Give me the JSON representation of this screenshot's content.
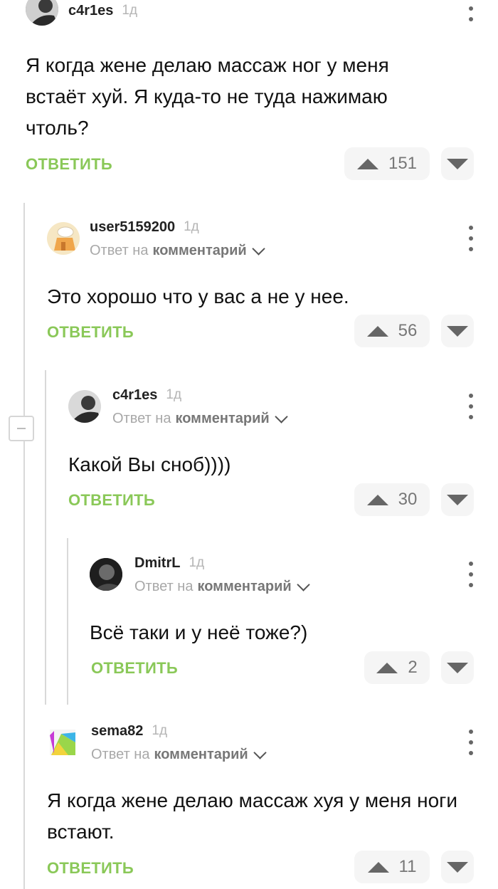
{
  "comments": [
    {
      "author": "c4r1es",
      "time": "1д",
      "text": "Я когда жене делаю массаж ног у меня встаёт хуй. Я куда-то не туда нажимаю чтоль?",
      "reply_label": "ОТВЕТИТЬ",
      "score": "151"
    },
    {
      "author": "user5159200",
      "time": "1д",
      "reply_to_prefix": "Ответ на",
      "reply_to_link": "комментарий",
      "text": "Это хорошо что у вас а не у нее.",
      "reply_label": "ОТВЕТИТЬ",
      "score": "56"
    },
    {
      "author": "c4r1es",
      "time": "1д",
      "reply_to_prefix": "Ответ на",
      "reply_to_link": "комментарий",
      "text": "Какой Вы сноб))))",
      "reply_label": "ОТВЕТИТЬ",
      "score": "30"
    },
    {
      "author": "DmitrL",
      "time": "1д",
      "reply_to_prefix": "Ответ на",
      "reply_to_link": "комментарий",
      "text": "Всё таки и у неё тоже?)",
      "reply_label": "ОТВЕТИТЬ",
      "score": "2"
    },
    {
      "author": "sema82",
      "time": "1д",
      "reply_to_prefix": "Ответ на",
      "reply_to_link": "комментарий",
      "text": "Я когда жене делаю массаж хуя у меня ноги встают.",
      "reply_label": "ОТВЕТИТЬ",
      "score": "11"
    }
  ],
  "colors": {
    "reply_button": "#8ac858",
    "thread_line": "#d9d9d9",
    "vote_background": "#f5f5f5"
  },
  "icons": [
    "avatar",
    "more-vertical-icon",
    "chevron-down-icon",
    "arrow-up-icon",
    "arrow-down-icon",
    "collapse-icon"
  ]
}
